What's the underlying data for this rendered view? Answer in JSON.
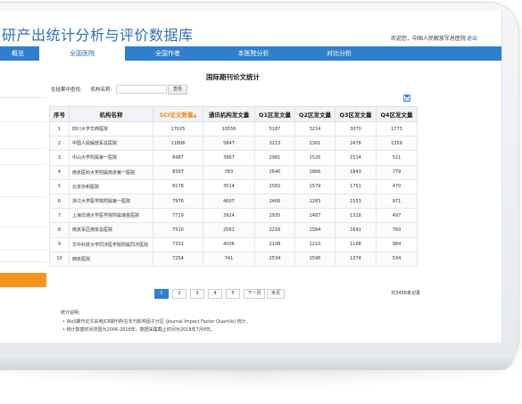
{
  "header": {
    "site_title": "研产出统计分析与评价数据库",
    "welcome": "欢迎您，中国人民解放军总医院",
    "logout": "退出"
  },
  "nav": {
    "items": [
      {
        "label": "概览",
        "active": false
      },
      {
        "label": "全国医院",
        "active": true
      },
      {
        "label": "全国作者",
        "active": false
      },
      {
        "label": "本医院分析",
        "active": false
      },
      {
        "label": "对比分析",
        "active": false
      }
    ]
  },
  "main": {
    "title": "国际期刊论文统计",
    "search_scope_label": "在结果中查找:",
    "institution_label": "机构名称:",
    "search_value": "",
    "search_button": "查找",
    "export_icon": "export-icon"
  },
  "table": {
    "headers": [
      "序号",
      "机构名称",
      "SCI论文数量",
      "通讯机构发文量",
      "Q1区发文量",
      "Q2区发文量",
      "Q3区发文量",
      "Q4区发文量"
    ],
    "sort_indicator": "▲",
    "rows": [
      [
        "1",
        "四川大学华西医院",
        "17025",
        "10556",
        "5187",
        "3214",
        "3070",
        "1773"
      ],
      [
        "2",
        "中国人民解放军总医院",
        "11806",
        "5847",
        "3213",
        "2301",
        "2478",
        "1359"
      ],
      [
        "3",
        "中山大学附属第一医院",
        "8487",
        "3967",
        "2981",
        "1526",
        "1514",
        "521"
      ],
      [
        "4",
        "南京医科大学附属南京第一医院",
        "8397",
        "783",
        "2640",
        "1866",
        "1843",
        "779"
      ],
      [
        "5",
        "北京协和医院",
        "8178",
        "3514",
        "2582",
        "1579",
        "1751",
        "470"
      ],
      [
        "6",
        "浙江大学医学院附属第一医院",
        "7976",
        "4607",
        "2406",
        "1283",
        "1553",
        "971"
      ],
      [
        "7",
        "上海交通大学医学院附属瑞金医院",
        "7719",
        "3924",
        "2935",
        "1487",
        "1318",
        "497"
      ],
      [
        "8",
        "南京军区南京总医院",
        "7510",
        "2561",
        "2216",
        "1584",
        "1641",
        "760"
      ],
      [
        "9",
        "华中科技大学同济医学院附属同济医院",
        "7331",
        "4006",
        "2108",
        "1210",
        "1168",
        "984"
      ],
      [
        "10",
        "西京医院",
        "7254",
        "741",
        "2534",
        "1596",
        "1374",
        "534"
      ]
    ]
  },
  "pagination": {
    "pages": [
      "1",
      "2",
      "3",
      "4",
      "5"
    ],
    "next": "下一页",
    "last": "末页",
    "total": "共3456条记录"
  },
  "notes": {
    "title": "统计说明:",
    "items": [
      "• WoS期刊论文采用JCR期刊所在年刊影响因子分区 (Journal Impact Factor Quartile) 统计。",
      "• 统计数据时间范围为2006-2018年，数据采集截止时间为2018年7月8日。"
    ]
  },
  "colors": {
    "primary_blue": "#2f7fcf",
    "title_blue": "#2f6fb0",
    "accent_orange": "#f7941d"
  }
}
